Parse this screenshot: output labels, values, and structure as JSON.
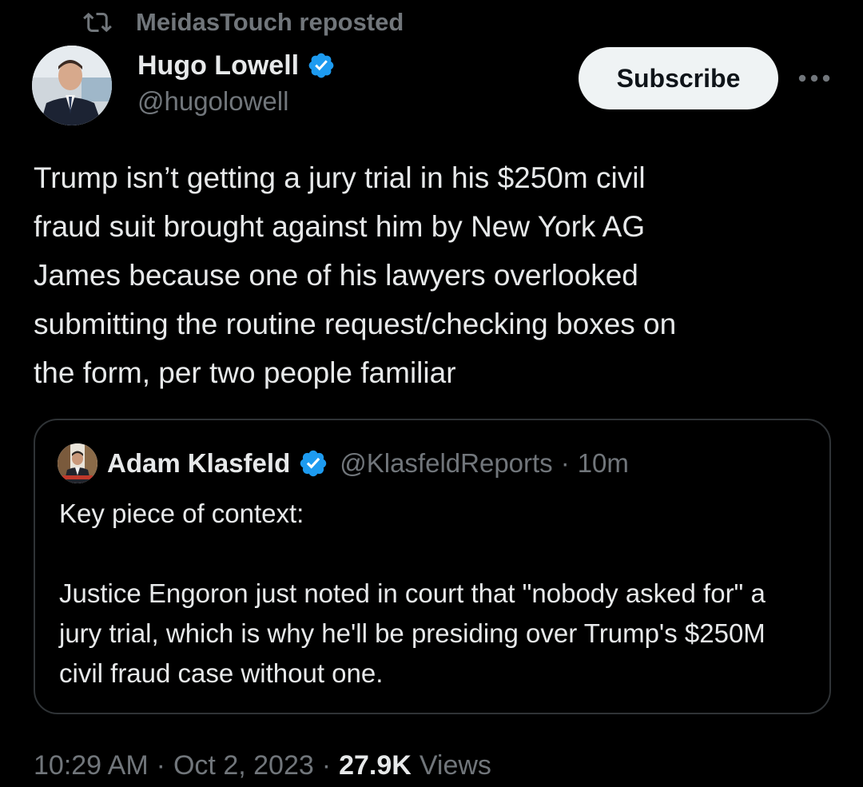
{
  "repost": {
    "icon": "repost-icon",
    "label": "MeidasTouch reposted"
  },
  "author": {
    "name": "Hugo Lowell",
    "handle": "@hugolowell",
    "verified": true,
    "verified_color": "#1d9bf0"
  },
  "actions": {
    "subscribe_label": "Subscribe",
    "more_icon": "more-icon"
  },
  "tweet": {
    "text": "Trump isn’t getting a jury trial in his $250m civil\nfraud suit brought against him by New York AG\nJames because one of his lawyers overlooked\nsubmitting the routine request/checking boxes on\nthe form, per two people familiar"
  },
  "quote": {
    "name": "Adam Klasfeld",
    "handle": "@KlasfeldReports",
    "separator": "·",
    "time": "10m",
    "verified": true,
    "paragraph1": "Key piece of context:",
    "paragraph2": "Justice Engoron just noted in court that \"nobody asked for\" a jury trial, which is why he'll be presiding over Trump's $250M civil fraud case without one."
  },
  "meta": {
    "time": "10:29 AM",
    "separator": "·",
    "date": "Oct 2, 2023",
    "views_count": "27.9K",
    "views_label": "Views"
  },
  "colors": {
    "background": "#000000",
    "text": "#e7e9ea",
    "secondary": "#71767b",
    "border": "#2f3336",
    "button_bg": "#eff3f4",
    "accent": "#1d9bf0"
  }
}
